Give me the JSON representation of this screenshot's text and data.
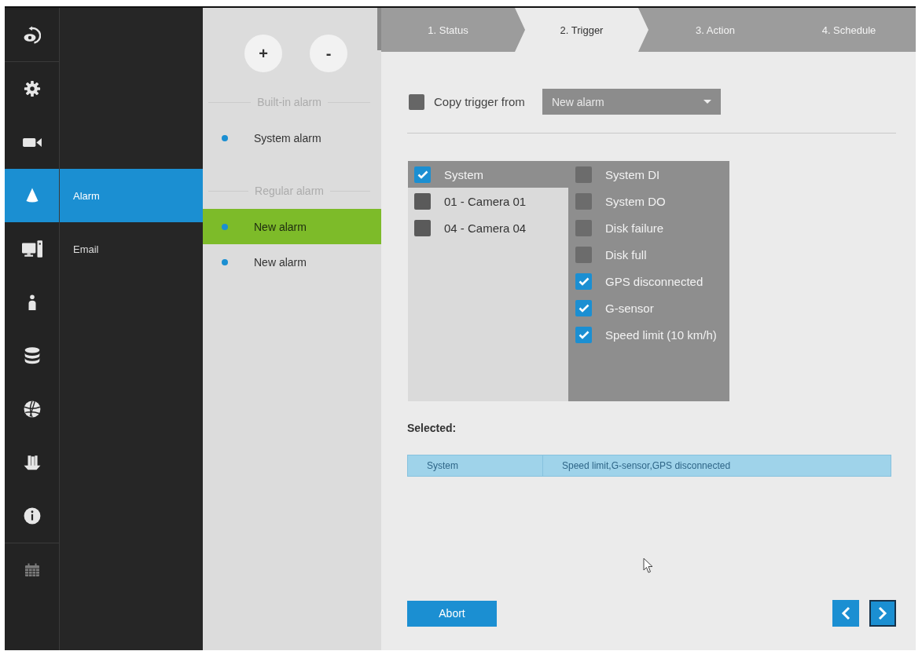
{
  "nav_rail": {
    "sections": [
      {
        "items": [
          {
            "selected": false,
            "disabled": false
          }
        ]
      },
      {
        "items": [
          {
            "selected": false,
            "disabled": false
          },
          {
            "selected": false,
            "disabled": false
          },
          {
            "selected": true,
            "disabled": false
          },
          {
            "selected": false,
            "disabled": false
          },
          {
            "selected": false,
            "disabled": false
          },
          {
            "selected": false,
            "disabled": false
          },
          {
            "selected": false,
            "disabled": false
          },
          {
            "selected": false,
            "disabled": false
          },
          {
            "selected": false,
            "disabled": false
          }
        ]
      },
      {
        "items": [
          {
            "selected": false,
            "disabled": true
          }
        ]
      }
    ]
  },
  "submenu": {
    "items": [
      {
        "label": "Alarm",
        "selected": true
      },
      {
        "label": "Email",
        "selected": false
      }
    ]
  },
  "alarm_list": {
    "buttons": [
      "+",
      "-"
    ],
    "groups": [
      {
        "title": "Built-in alarm",
        "items": [
          {
            "label": "System alarm",
            "selected": false
          }
        ]
      },
      {
        "title": "Regular alarm",
        "items": [
          {
            "label": "New alarm",
            "selected": true
          },
          {
            "label": "New alarm",
            "selected": false
          }
        ]
      }
    ]
  },
  "wizard": {
    "steps": [
      {
        "label": "1. Status",
        "selected": false
      },
      {
        "label": "2. Trigger",
        "selected": true
      },
      {
        "label": "3. Action",
        "selected": false
      },
      {
        "label": "4. Schedule",
        "selected": false
      }
    ]
  },
  "copy_trigger": {
    "label": "Copy trigger from",
    "checked": false,
    "dropdown_value": "New alarm"
  },
  "trigger": {
    "sources": [
      {
        "label": "System",
        "checked": true,
        "selected": true
      },
      {
        "label": "01 - Camera 01",
        "checked": false,
        "selected": false
      },
      {
        "label": "04 - Camera 04",
        "checked": false,
        "selected": false
      }
    ],
    "events": [
      {
        "label": "System DI",
        "checked": false
      },
      {
        "label": "System DO",
        "checked": false
      },
      {
        "label": "Disk failure",
        "checked": false
      },
      {
        "label": "Disk full",
        "checked": false
      },
      {
        "label": "GPS disconnected",
        "checked": true
      },
      {
        "label": "G-sensor",
        "checked": true
      },
      {
        "label": "Speed limit (10 km/h)",
        "checked": true
      }
    ]
  },
  "selected": {
    "title": "Selected:",
    "rows": [
      {
        "source": "System",
        "events": "Speed limit,G-sensor,GPS disconnected"
      }
    ]
  },
  "footer": {
    "abort": "Abort",
    "pager": [
      {
        "focused": false
      },
      {
        "focused": true
      }
    ]
  }
}
